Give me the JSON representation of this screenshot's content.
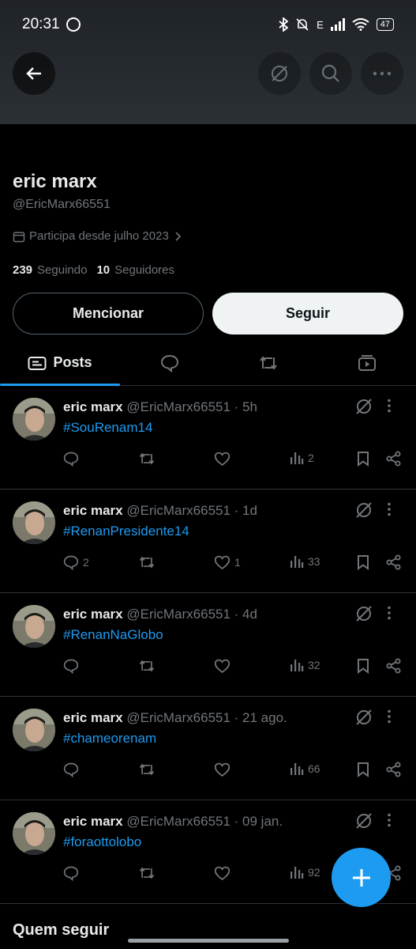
{
  "status_bar": {
    "time": "20:31",
    "network": "E",
    "battery": "47"
  },
  "profile": {
    "name": "eric marx",
    "handle": "@EricMarx66551",
    "joined": "Participa desde julho 2023",
    "following_count": "239",
    "following_label": "Seguindo",
    "followers_count": "10",
    "followers_label": "Seguidores"
  },
  "buttons": {
    "mention": "Mencionar",
    "follow": "Seguir"
  },
  "tabs": {
    "posts": "Posts"
  },
  "posts": [
    {
      "name": "eric marx",
      "meta": "@EricMarx66551 · 5h",
      "hashtag": "#SouRenam14",
      "replies": "",
      "likes": "",
      "views": "2"
    },
    {
      "name": "eric marx",
      "meta": "@EricMarx66551 · 1d",
      "hashtag": "#RenanPresidente14",
      "replies": "2",
      "likes": "1",
      "views": "33"
    },
    {
      "name": "eric marx",
      "meta": "@EricMarx66551 · 4d",
      "hashtag": "#RenanNaGlobo",
      "replies": "",
      "likes": "",
      "views": "32"
    },
    {
      "name": "eric marx",
      "meta": "@EricMarx66551 · 21 ago.",
      "hashtag": "#chameorenam",
      "replies": "",
      "likes": "",
      "views": "66"
    },
    {
      "name": "eric marx",
      "meta": "@EricMarx66551 · 09 jan.",
      "hashtag": "#foraottolobo",
      "replies": "",
      "likes": "",
      "views": "92"
    }
  ],
  "who_to_follow": "Quem seguir",
  "colors": {
    "accent": "#1d9bf0",
    "background": "#000000",
    "muted_text": "#71767b",
    "divider": "#2f3336"
  }
}
